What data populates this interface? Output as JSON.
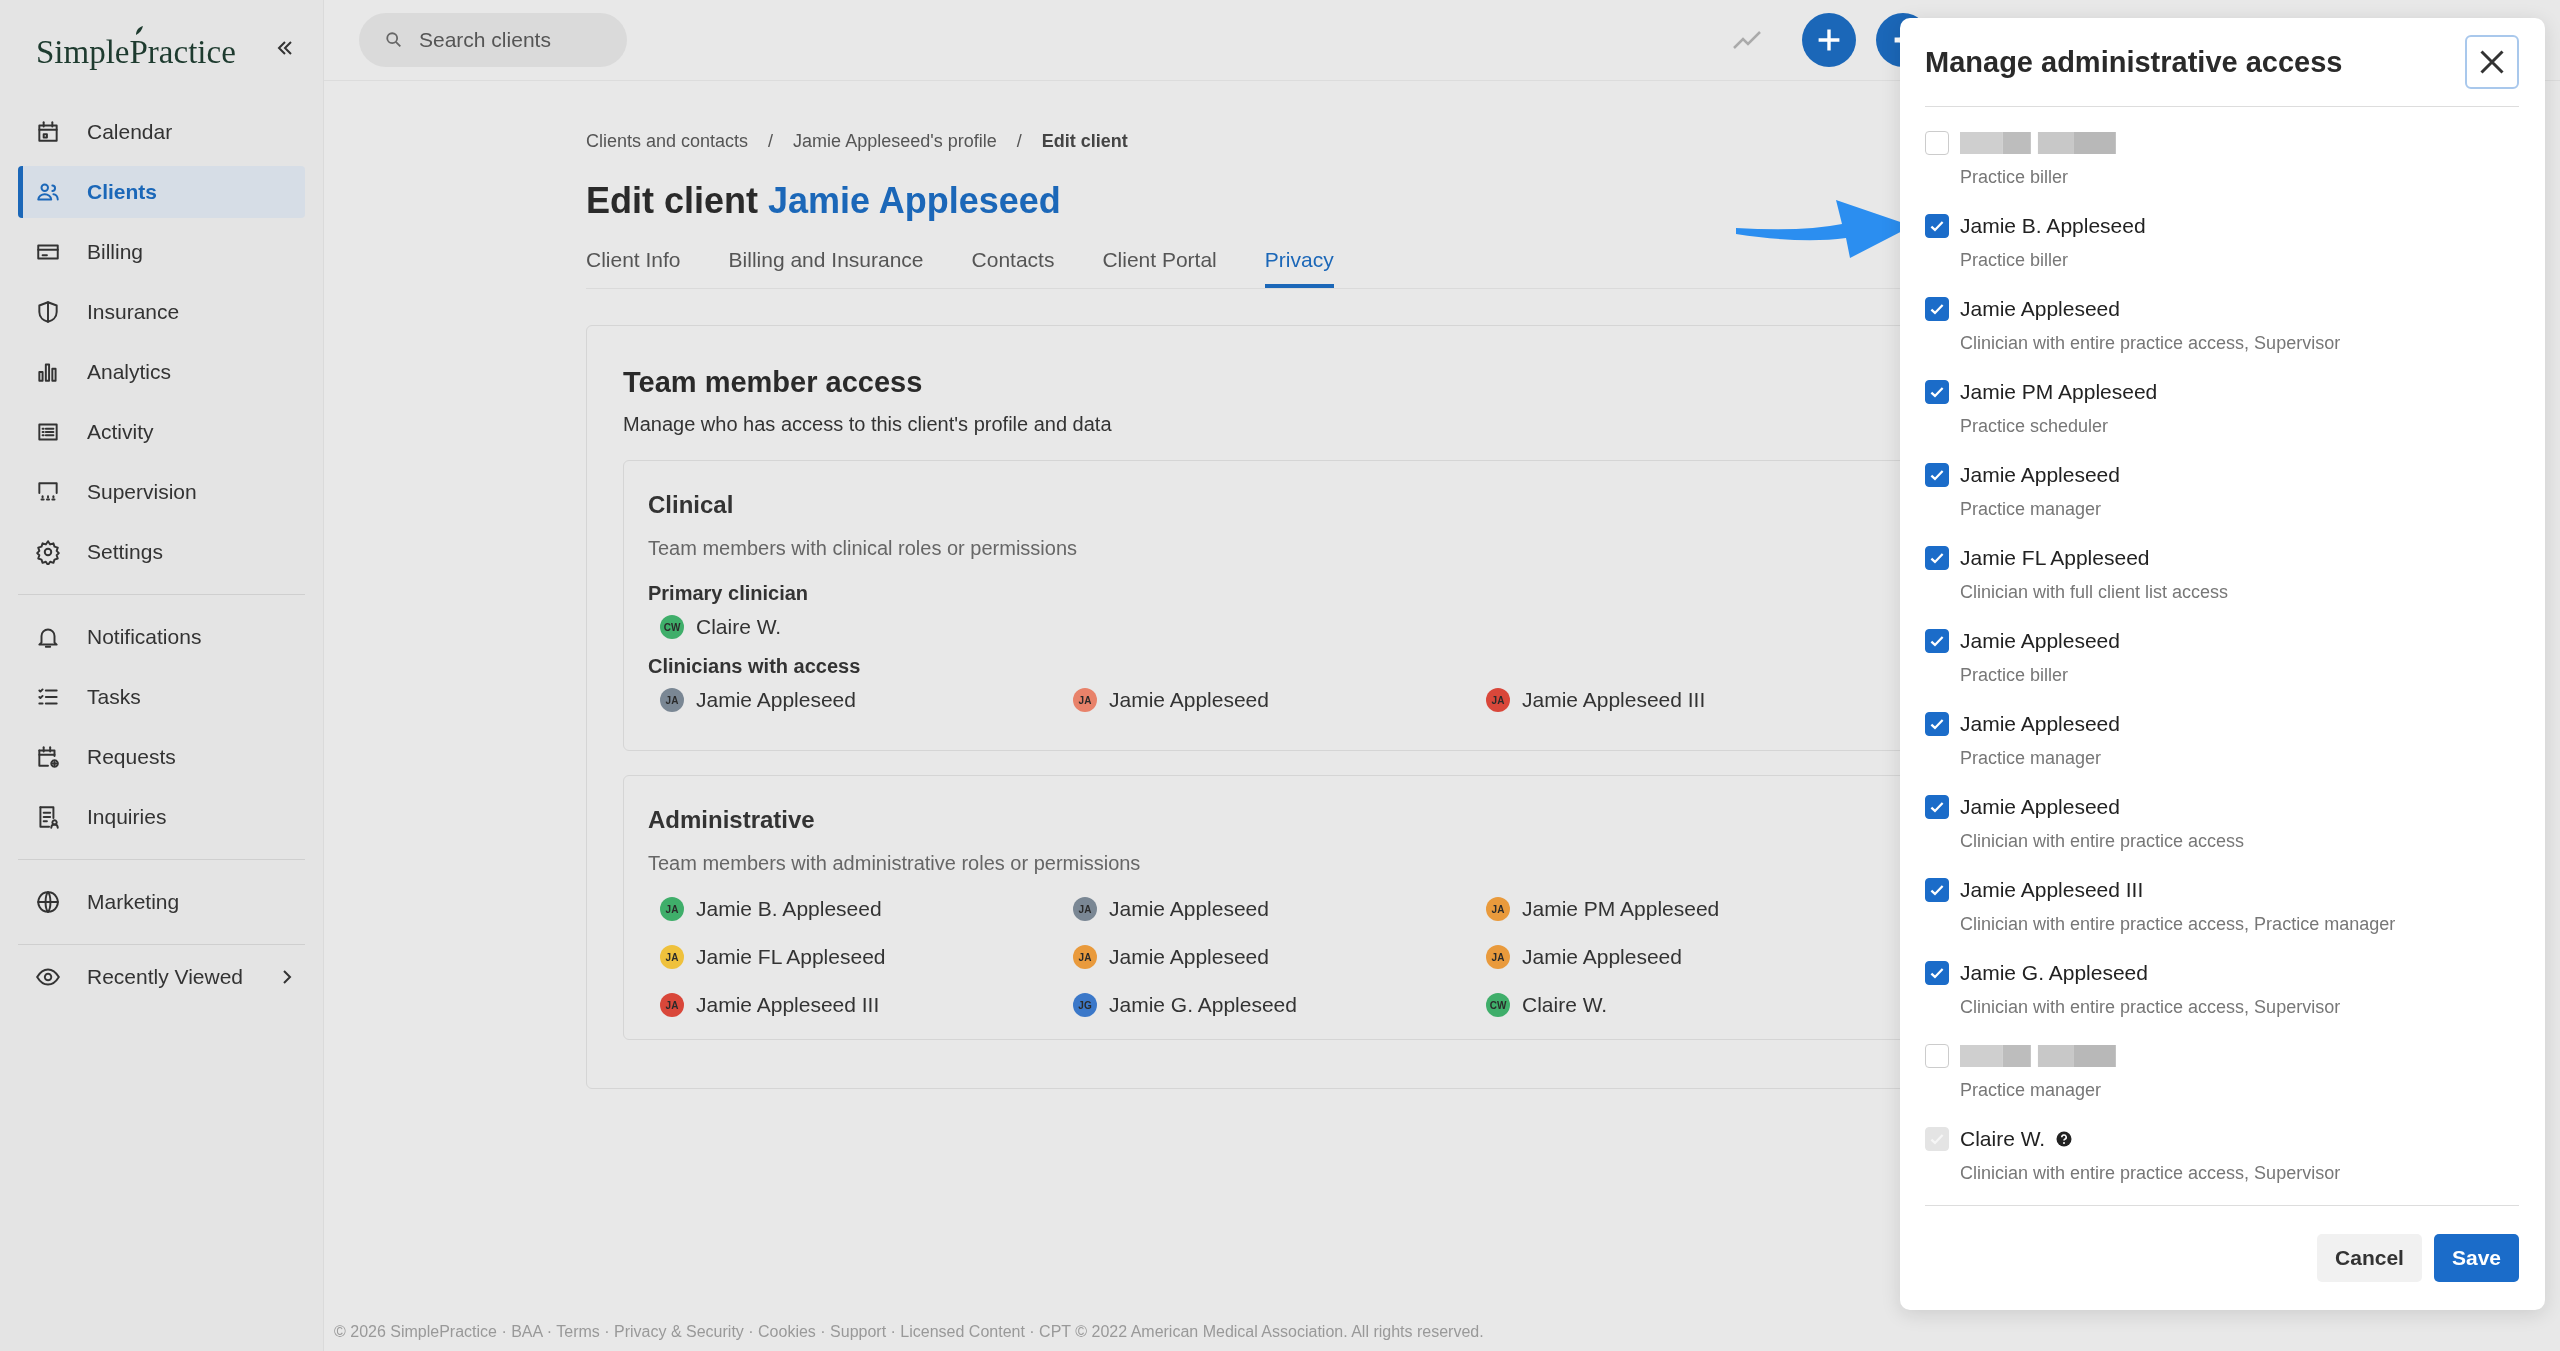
{
  "sidebar": {
    "logo": "SimplePractice",
    "groups": [
      [
        {
          "label": "Calendar",
          "selected": false
        },
        {
          "label": "Clients",
          "selected": true
        },
        {
          "label": "Billing",
          "selected": false
        },
        {
          "label": "Insurance",
          "selected": false
        },
        {
          "label": "Analytics",
          "selected": false
        },
        {
          "label": "Activity",
          "selected": false
        },
        {
          "label": "Supervision",
          "selected": false
        },
        {
          "label": "Settings",
          "selected": false
        }
      ],
      [
        {
          "label": "Notifications",
          "selected": false
        },
        {
          "label": "Tasks",
          "selected": false
        },
        {
          "label": "Requests",
          "selected": false
        },
        {
          "label": "Inquiries",
          "selected": false
        }
      ],
      [
        {
          "label": "Marketing",
          "selected": false
        }
      ]
    ],
    "recently_viewed": "Recently Viewed"
  },
  "topbar": {
    "search": {
      "placeholder": "Search clients"
    }
  },
  "breadcrumb": [
    {
      "label": "Clients and contacts",
      "current": false
    },
    {
      "label": "Jamie Appleseed's profile",
      "current": false
    },
    {
      "label": "Edit client",
      "current": true
    }
  ],
  "breadcrumb_separator": "/",
  "title": {
    "prefix": "Edit client",
    "client": "Jamie Appleseed"
  },
  "tabs": [
    {
      "label": "Client Info",
      "selected": false
    },
    {
      "label": "Billing and Insurance",
      "selected": false
    },
    {
      "label": "Contacts",
      "selected": false
    },
    {
      "label": "Client Portal",
      "selected": false
    },
    {
      "label": "Privacy",
      "selected": true
    }
  ],
  "team_access": {
    "title": "Team member access",
    "subtitle": "Manage who has access to this client's profile and data",
    "clinical": {
      "title": "Clinical",
      "subtitle": "Team members with clinical roles or permissions",
      "groups": [
        {
          "heading": "Primary clinician",
          "members": [
            {
              "initials": "CW",
              "name": "Claire W.",
              "color": "#3fae6a"
            }
          ]
        },
        {
          "heading": "Clinicians with access",
          "members": [
            {
              "initials": "JA",
              "name": "Jamie Appleseed",
              "color": "#7a8794"
            },
            {
              "initials": "JA",
              "name": "Jamie Appleseed",
              "color": "#e8826a"
            },
            {
              "initials": "JA",
              "name": "Jamie Appleseed III",
              "color": "#d9473a"
            }
          ]
        }
      ]
    },
    "administrative": {
      "title": "Administrative",
      "subtitle": "Team members with administrative roles or permissions",
      "members": [
        {
          "initials": "JA",
          "name": "Jamie B. Appleseed",
          "color": "#3fae6a"
        },
        {
          "initials": "JA",
          "name": "Jamie Appleseed",
          "color": "#7a8794"
        },
        {
          "initials": "JA",
          "name": "Jamie PM Appleseed",
          "color": "#e99a3c"
        },
        {
          "initials": "JA",
          "name": "Jamie FL Appleseed",
          "color": "#efc13c"
        },
        {
          "initials": "JA",
          "name": "Jamie Appleseed",
          "color": "#e99a3c"
        },
        {
          "initials": "JA",
          "name": "Jamie Appleseed",
          "color": "#e99a3c"
        },
        {
          "initials": "JA",
          "name": "Jamie Appleseed III",
          "color": "#d9473a"
        },
        {
          "initials": "JG",
          "name": "Jamie G. Appleseed",
          "color": "#3b78c9"
        },
        {
          "initials": "CW",
          "name": "Claire W.",
          "color": "#3fae6a"
        }
      ]
    }
  },
  "footer": "© 2026 SimplePractice · BAA · Terms · Privacy & Security · Cookies · Support · Licensed Content · CPT © 2022 American Medical Association. All rights reserved.",
  "dialog": {
    "title": "Manage administrative access",
    "items": [
      {
        "kind": "redacted",
        "checked": false,
        "disabled": false,
        "role": "Practice biller"
      },
      {
        "kind": "named",
        "name": "Jamie B. Appleseed",
        "checked": true,
        "disabled": false,
        "role": "Practice biller"
      },
      {
        "kind": "named",
        "name": "Jamie Appleseed",
        "checked": true,
        "disabled": false,
        "role": "Clinician with entire practice access, Supervisor"
      },
      {
        "kind": "named",
        "name": "Jamie PM Appleseed",
        "checked": true,
        "disabled": false,
        "role": "Practice scheduler"
      },
      {
        "kind": "named",
        "name": "Jamie Appleseed",
        "checked": true,
        "disabled": false,
        "role": "Practice manager"
      },
      {
        "kind": "named",
        "name": "Jamie FL Appleseed",
        "checked": true,
        "disabled": false,
        "role": "Clinician with full client list access"
      },
      {
        "kind": "named",
        "name": "Jamie Appleseed",
        "checked": true,
        "disabled": false,
        "role": "Practice biller"
      },
      {
        "kind": "named",
        "name": "Jamie Appleseed",
        "checked": true,
        "disabled": false,
        "role": "Practice manager"
      },
      {
        "kind": "named",
        "name": "Jamie Appleseed",
        "checked": true,
        "disabled": false,
        "role": "Clinician with entire practice access"
      },
      {
        "kind": "named",
        "name": "Jamie Appleseed III",
        "checked": true,
        "disabled": false,
        "role": "Clinician with entire practice access, Practice manager"
      },
      {
        "kind": "named",
        "name": "Jamie G. Appleseed",
        "checked": true,
        "disabled": false,
        "role": "Clinician with entire practice access, Supervisor"
      },
      {
        "kind": "redacted",
        "checked": false,
        "disabled": false,
        "role": "Practice manager"
      },
      {
        "kind": "named",
        "name": "Claire W.",
        "checked": true,
        "disabled": true,
        "role": "Clinician with entire practice access, Supervisor"
      }
    ],
    "buttons": {
      "cancel": "Cancel",
      "save": "Save"
    }
  }
}
